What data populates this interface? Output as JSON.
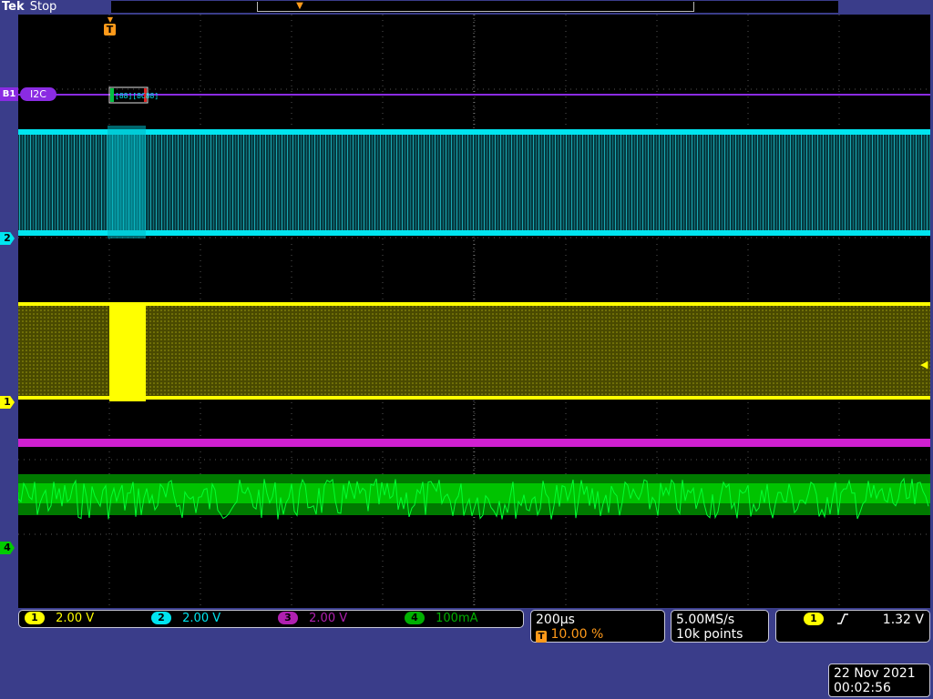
{
  "header": {
    "brand": "Tek",
    "acq_state": "Stop",
    "record_marker_icon": "trigger-position-marker",
    "trigger_marker_label": "T"
  },
  "bus": {
    "id": "B1",
    "protocol": "I2C"
  },
  "channels": [
    {
      "id": "1",
      "scale": "2.00 V",
      "color": "#ffff00"
    },
    {
      "id": "2",
      "scale": "2.00 V",
      "color": "#00e5f0"
    },
    {
      "id": "3",
      "scale": "2.00 V",
      "color": "#d020d0"
    },
    {
      "id": "4",
      "scale": "100mA",
      "color": "#00cc00"
    }
  ],
  "timebase": {
    "scale": "200µs",
    "trigger_position_icon": "T",
    "trigger_position": "10.00 %"
  },
  "acquisition": {
    "sample_rate": "5.00MS/s",
    "record_length": "10k points"
  },
  "trigger": {
    "source": "1",
    "slope_icon": "rising-edge-icon",
    "level": "1.32 V"
  },
  "datetime": {
    "date": "22 Nov 2021",
    "time": "00:02:56"
  },
  "colors": {
    "background": "#3a3d8a",
    "screen": "#000000",
    "trigger_orange": "#ff9a1a",
    "bus_purple": "#8a2be2"
  }
}
